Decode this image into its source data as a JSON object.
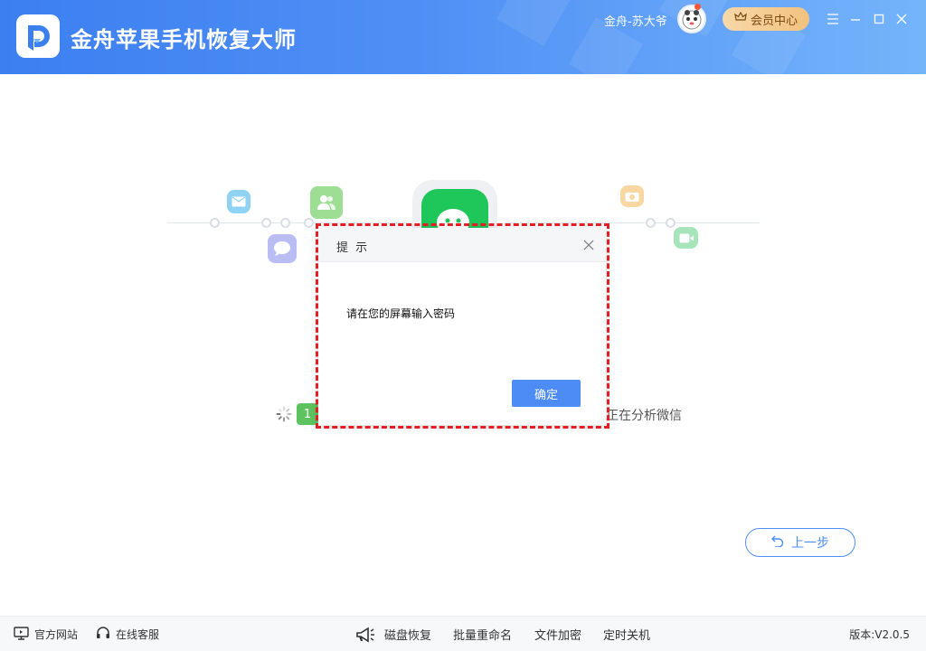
{
  "header": {
    "title": "金舟苹果手机恢复大师",
    "username": "金舟-苏大爷",
    "member_label": "会员中心",
    "colors": {
      "gradient_start": "#3c7ff0",
      "gradient_end": "#74b4fb",
      "member_bg": "#f2c27e"
    }
  },
  "window_controls": {
    "menu_icon": "hamburger-icon",
    "minimize_icon": "minimize-icon",
    "maximize_icon": "maximize-icon",
    "close_icon": "close-icon"
  },
  "illustration": {
    "icons": [
      "mail-icon",
      "contacts-icon",
      "chat-icon",
      "wechat-icon",
      "camera-icon",
      "video-icon"
    ]
  },
  "progress": {
    "step": "1",
    "status_text": "正在分析微信"
  },
  "dialog": {
    "title": "提 示",
    "message": "请在您的屏幕输入密码",
    "ok_label": "确定"
  },
  "back_button": {
    "label": "上一步"
  },
  "footer": {
    "official_site": "官方网站",
    "online_service": "在线客服",
    "tools": [
      "磁盘恢复",
      "批量重命名",
      "文件加密",
      "定时关机"
    ],
    "version": "版本:V2.0.5"
  },
  "colors": {
    "accent": "#4d8cf5",
    "highlight": "#e31e24",
    "wechat_green": "#1fc65a"
  }
}
